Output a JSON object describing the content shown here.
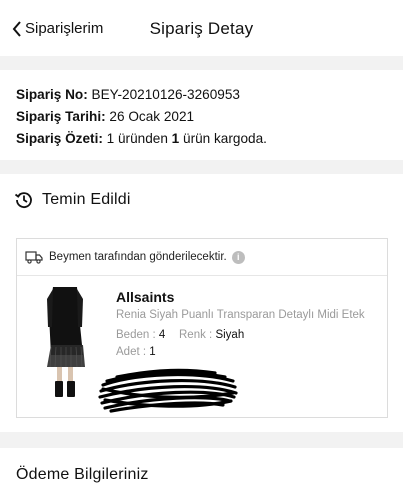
{
  "header": {
    "back_label": "Siparişlerim",
    "title": "Sipariş Detay"
  },
  "order": {
    "number_label": "Sipariş No:",
    "number_value": "BEY-20210126-3260953",
    "date_label": "Sipariş Tarihi:",
    "date_value": "26 Ocak 2021",
    "summary_label": "Sipariş Özeti:",
    "summary_count_a": "1",
    "summary_mid": "üründen",
    "summary_count_b": "1",
    "summary_end": "ürün kargoda."
  },
  "status": {
    "icon": "history-icon",
    "label": "Temin Edildi"
  },
  "shipment": {
    "shipper_note": "Beymen tarafından gönderilecektir.",
    "info_glyph": "i"
  },
  "product": {
    "brand": "Allsaints",
    "name": "Renia Siyah Puanlı Transparan Detaylı Midi Etek",
    "size_label": "Beden :",
    "size_value": "4",
    "color_label": "Renk :",
    "color_value": "Siyah",
    "qty_label": "Adet :",
    "qty_value": "1"
  },
  "payment": {
    "title": "Ödeme Bilgileriniz"
  }
}
